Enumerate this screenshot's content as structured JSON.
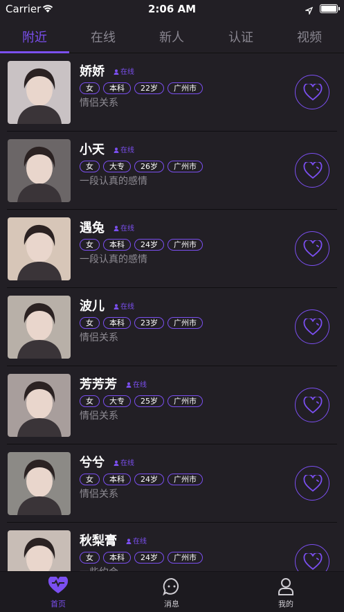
{
  "status_bar": {
    "carrier": "Carrier",
    "time": "2:06 AM"
  },
  "tabs": [
    {
      "label": "附近",
      "active": true
    },
    {
      "label": "在线"
    },
    {
      "label": "新人"
    },
    {
      "label": "认证"
    },
    {
      "label": "视频"
    }
  ],
  "online_label": "在线",
  "users": [
    {
      "name": "娇娇",
      "tags": [
        "女",
        "本科",
        "22岁",
        "广州市"
      ],
      "bio": "情侣关系",
      "photo_bg": "#c9c2c4"
    },
    {
      "name": "小天",
      "tags": [
        "女",
        "大专",
        "26岁",
        "广州市"
      ],
      "bio": "一段认真的感情",
      "photo_bg": "#6b6667"
    },
    {
      "name": "遇兔",
      "tags": [
        "女",
        "本科",
        "24岁",
        "广州市"
      ],
      "bio": "一段认真的感情",
      "photo_bg": "#d7c6b8"
    },
    {
      "name": "波儿",
      "tags": [
        "女",
        "本科",
        "23岁",
        "广州市"
      ],
      "bio": "情侣关系",
      "photo_bg": "#b8b0a8"
    },
    {
      "name": "芳芳芳",
      "tags": [
        "女",
        "大专",
        "25岁",
        "广州市"
      ],
      "bio": "情侣关系",
      "photo_bg": "#a89e9c"
    },
    {
      "name": "兮兮",
      "tags": [
        "女",
        "本科",
        "24岁",
        "广州市"
      ],
      "bio": "情侣关系",
      "photo_bg": "#8c8a86"
    },
    {
      "name": "秋梨膏",
      "tags": [
        "女",
        "本科",
        "24岁",
        "广州市"
      ],
      "bio": "一些约会",
      "photo_bg": "#c8bdb6"
    }
  ],
  "tab_bar": [
    {
      "label": "首页",
      "icon": "heart-icon",
      "active": true
    },
    {
      "label": "消息",
      "icon": "chat-icon"
    },
    {
      "label": "我的",
      "icon": "person-icon"
    }
  ],
  "colors": {
    "accent": "#7b4ff0",
    "background": "#221f25"
  }
}
